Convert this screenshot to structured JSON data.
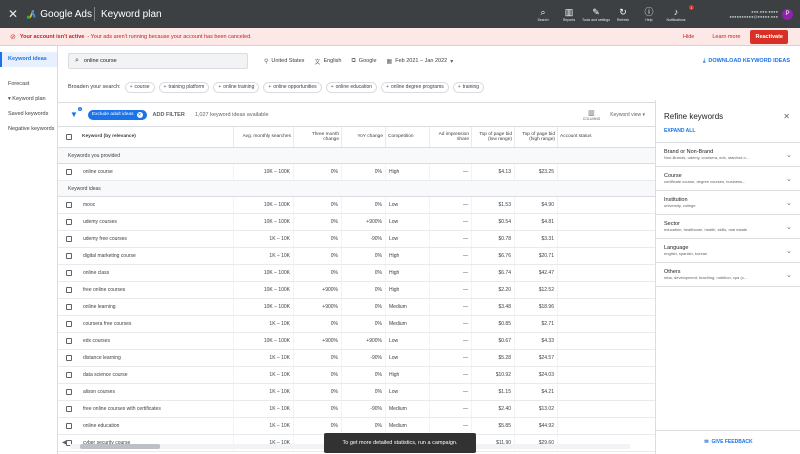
{
  "app": {
    "product": "Google Ads",
    "page_title": "Keyword plan",
    "account_line1": "●●●-●●●-●●●●",
    "account_line2": "●●●●●●●●●●@●●●●●.●●●",
    "avatar_initial": "P"
  },
  "topbar_icons": [
    {
      "icon": "search-icon",
      "glyph": "🔍",
      "label": "Search"
    },
    {
      "icon": "reports-icon",
      "glyph": "▥",
      "label": "Reports"
    },
    {
      "icon": "tools-icon",
      "glyph": "🔧",
      "label": "Tools and settings"
    },
    {
      "icon": "refresh-icon",
      "glyph": "↻",
      "label": "Refresh"
    },
    {
      "icon": "help-icon",
      "glyph": "?",
      "label": "Help"
    },
    {
      "icon": "notifications-icon",
      "glyph": "🔔",
      "label": "Notifications",
      "badge": "1"
    }
  ],
  "alert": {
    "title": "Your account isn't active",
    "message": " - Your ads aren't running because your account has been canceled.",
    "hide": "Hide",
    "learn_more": "Learn more",
    "reactivate": "Reactivate"
  },
  "nav": [
    "Keyword ideas",
    "Forecast",
    "▾ Keyword plan",
    "Saved keywords",
    "Negative keywords"
  ],
  "search": {
    "value": "online course",
    "location": "United States",
    "language": "English",
    "network": "Google",
    "date_range": "Feb 2021 – Jan 2022",
    "download": "DOWNLOAD KEYWORD IDEAS"
  },
  "broaden": {
    "label": "Broaden your search:",
    "chips": [
      "course",
      "training platform",
      "online training",
      "online opportunities",
      "online education",
      "online degree programs",
      "training"
    ]
  },
  "toolbar": {
    "filter_badge": "1",
    "exclude_chip": "Exclude adult ideas",
    "add_filter": "ADD FILTER",
    "count": "1,027 keyword ideas available",
    "columns": "COLUMNS",
    "view": "Keyword view ▾"
  },
  "columns": [
    "Keyword (by relevance)",
    "Avg. monthly searches",
    "Three month change",
    "YoY change",
    "Competition",
    "Ad impression share",
    "Top of page bid (low range)",
    "Top of page bid (high range)",
    "Account status"
  ],
  "provided_label": "Keywords you provided",
  "provided": [
    [
      "online course",
      "10K – 100K",
      "0%",
      "0%",
      "High",
      "—",
      "$4.13",
      "$23.25"
    ]
  ],
  "ideas_label": "Keyword ideas",
  "ideas": [
    [
      "mooc",
      "10K – 100K",
      "0%",
      "0%",
      "Low",
      "—",
      "$1.53",
      "$4.90"
    ],
    [
      "udemy courses",
      "10K – 100K",
      "0%",
      "+900%",
      "Low",
      "—",
      "$0.54",
      "$4.81"
    ],
    [
      "udemy free courses",
      "1K – 10K",
      "0%",
      "-90%",
      "Low",
      "—",
      "$0.78",
      "$3.31"
    ],
    [
      "digital marketing course",
      "1K – 10K",
      "0%",
      "0%",
      "High",
      "—",
      "$6.76",
      "$20.71"
    ],
    [
      "online class",
      "10K – 100K",
      "0%",
      "0%",
      "High",
      "—",
      "$6.74",
      "$42.47"
    ],
    [
      "free online courses",
      "10K – 100K",
      "+900%",
      "0%",
      "High",
      "—",
      "$2.20",
      "$12.52"
    ],
    [
      "online learning",
      "10K – 100K",
      "+900%",
      "0%",
      "Medium",
      "—",
      "$3.48",
      "$18.96"
    ],
    [
      "coursera free courses",
      "1K – 10K",
      "0%",
      "0%",
      "Medium",
      "—",
      "$0.85",
      "$2.71"
    ],
    [
      "edx courses",
      "10K – 100K",
      "+900%",
      "+900%",
      "Low",
      "—",
      "$0.67",
      "$4.33"
    ],
    [
      "distance learning",
      "1K – 10K",
      "0%",
      "-90%",
      "Low",
      "—",
      "$5.28",
      "$24.57"
    ],
    [
      "data science course",
      "1K – 10K",
      "0%",
      "0%",
      "High",
      "—",
      "$10.92",
      "$24.03"
    ],
    [
      "alison courses",
      "1K – 10K",
      "0%",
      "0%",
      "Low",
      "—",
      "$1.15",
      "$4.21"
    ],
    [
      "free online courses with certificates",
      "1K – 10K",
      "0%",
      "-90%",
      "Medium",
      "—",
      "$2.40",
      "$13.02"
    ],
    [
      "online education",
      "1K – 10K",
      "0%",
      "0%",
      "Medium",
      "—",
      "$5.85",
      "$44.92"
    ],
    [
      "cyber security course",
      "1K – 10K",
      "0%",
      "0%",
      "High",
      "—",
      "$11.90",
      "$29.60"
    ]
  ],
  "refine": {
    "title": "Refine keywords",
    "expand_all": "EXPAND ALL",
    "facets": [
      {
        "name": "Brand or Non-Brand",
        "desc": "Non-Brands, udemy, coursera, edx, stanford o..."
      },
      {
        "name": "Course",
        "desc": "certificate course, degree courses, business..."
      },
      {
        "name": "Institution",
        "desc": "university, college"
      },
      {
        "name": "Sector",
        "desc": "education, healthcare, health, skills, real estate"
      },
      {
        "name": "Language",
        "desc": "english, spanish, korean"
      },
      {
        "name": "Others",
        "desc": "mba, development, teaching, nutrition, cpa (c..."
      }
    ],
    "feedback": "GIVE FEEDBACK"
  },
  "toast": "To get more detailed statistics, run a campaign."
}
